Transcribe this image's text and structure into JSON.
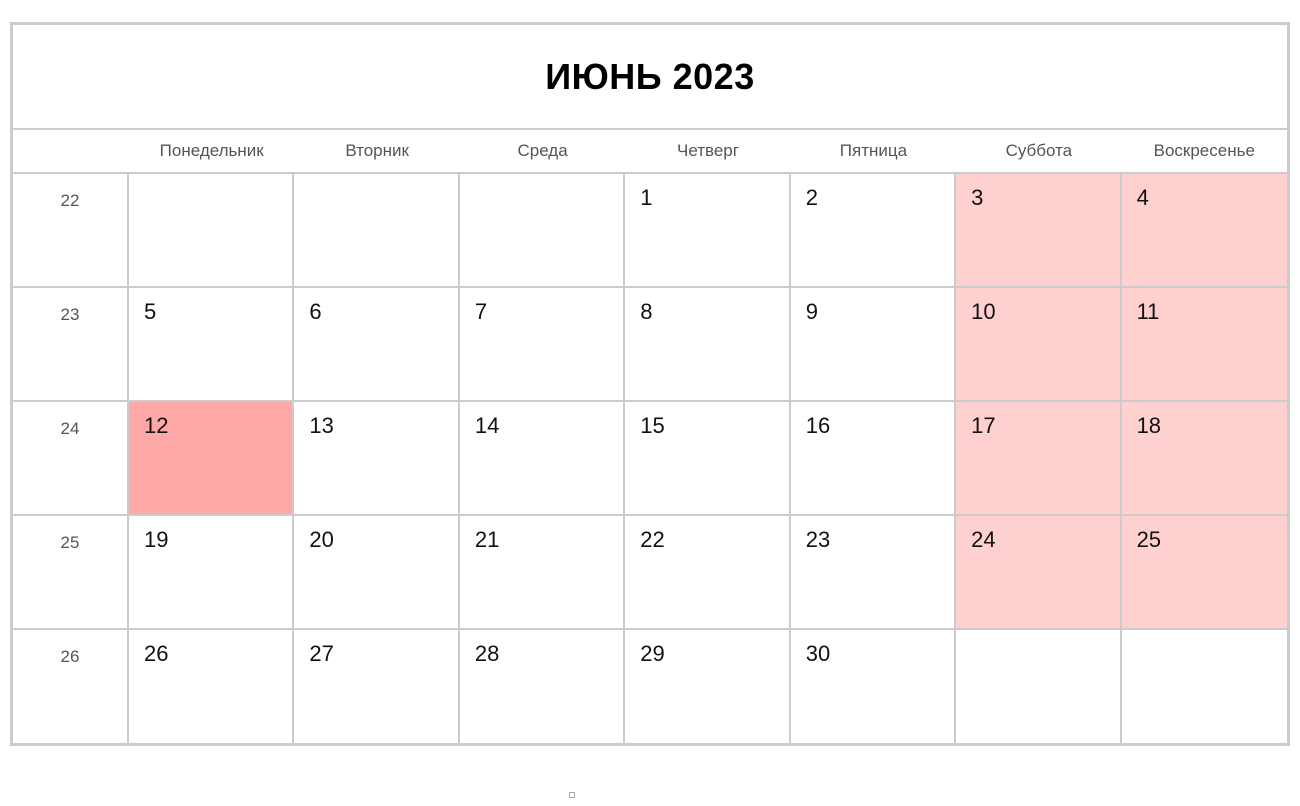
{
  "calendar": {
    "title": "ИЮНЬ 2023",
    "weekdays": [
      "Понедельник",
      "Вторник",
      "Среда",
      "Четверг",
      "Пятница",
      "Суббота",
      "Воскресенье"
    ],
    "colors": {
      "weekend": "#ffd0d0",
      "holiday": "#ffa8a8",
      "border": "#cccccc"
    },
    "weeks": [
      {
        "num": "22",
        "days": [
          "",
          "",
          "",
          "1",
          "2",
          "3",
          "4"
        ]
      },
      {
        "num": "23",
        "days": [
          "5",
          "6",
          "7",
          "8",
          "9",
          "10",
          "11"
        ]
      },
      {
        "num": "24",
        "days": [
          "12",
          "13",
          "14",
          "15",
          "16",
          "17",
          "18"
        ]
      },
      {
        "num": "25",
        "days": [
          "19",
          "20",
          "21",
          "22",
          "23",
          "24",
          "25"
        ]
      },
      {
        "num": "26",
        "days": [
          "26",
          "27",
          "28",
          "29",
          "30",
          "",
          ""
        ]
      }
    ],
    "holidays": [
      "12"
    ]
  }
}
